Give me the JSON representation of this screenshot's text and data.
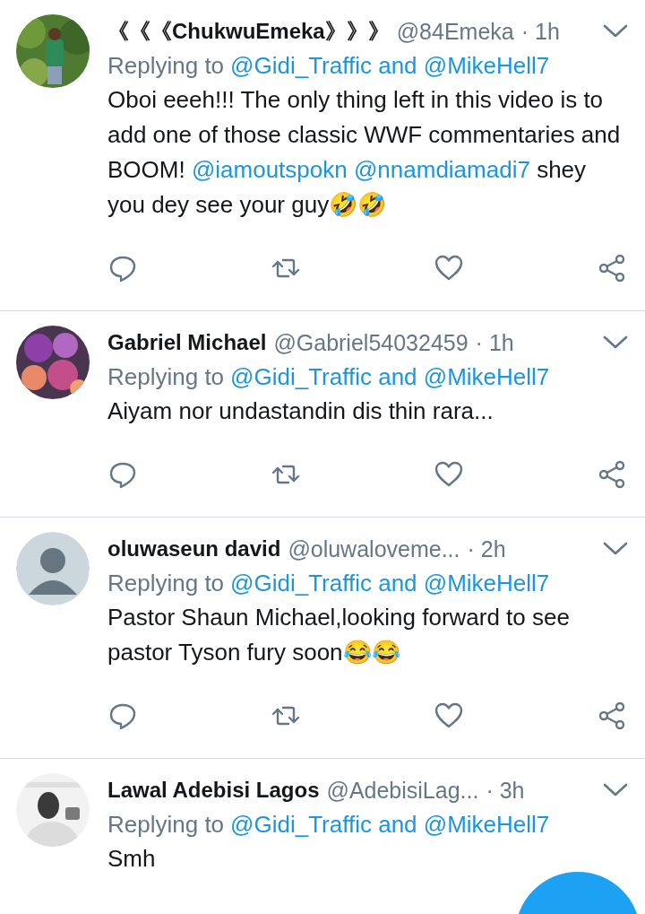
{
  "tweets": [
    {
      "name": "《《《ChukwuEmeka》》》",
      "handle": "@84Emeka",
      "time": "· 1h",
      "replying_prefix": "Replying to",
      "replying_to": "@Gidi_Traffic and @MikeHell7",
      "body": [
        {
          "kind": "text",
          "text": "Oboi eeeh!!! The only thing left in this video is to add one of those classic WWF commentaries and BOOM! "
        },
        {
          "kind": "mention",
          "text": "@iamoutspokn"
        },
        {
          "kind": "mention",
          "text": "@nnamdiamadi7"
        },
        {
          "kind": "text",
          "text": " shey you dey see your guy🤣🤣"
        }
      ],
      "actions": [
        {
          "kind": "reply"
        },
        {
          "kind": "retweet"
        },
        {
          "kind": "like"
        },
        {
          "kind": "share"
        }
      ]
    },
    {
      "name": "Gabriel Michael",
      "handle": "@Gabriel54032459",
      "time": "· 1h",
      "replying_prefix": "Replying to",
      "replying_to": "@Gidi_Traffic and @MikeHell7",
      "body": [
        {
          "kind": "text",
          "text": "Aiyam nor undastandin dis thin rara..."
        }
      ],
      "actions": [
        {
          "kind": "reply"
        },
        {
          "kind": "retweet"
        },
        {
          "kind": "like"
        },
        {
          "kind": "share"
        }
      ]
    },
    {
      "avatar": {
        "kind": "default"
      },
      "name": "oluwaseun david",
      "handle": "@oluwaloveme...",
      "time": "· 2h",
      "replying_prefix": "Replying to",
      "replying_to": "@Gidi_Traffic and @MikeHell7",
      "body": [
        {
          "kind": "text",
          "text": "Pastor Shaun Michael,looking forward to see pastor Tyson fury soon😂😂"
        }
      ],
      "actions": [
        {
          "kind": "reply"
        },
        {
          "kind": "retweet"
        },
        {
          "kind": "like"
        },
        {
          "kind": "share"
        }
      ]
    },
    {
      "name": "Lawal Adebisi Lagos",
      "handle": "@AdebisiLag...",
      "time": "· 3h",
      "replying_prefix": "Replying to",
      "replying_to": "@Gidi_Traffic and @MikeHell7",
      "body": [
        {
          "kind": "text",
          "text": "Smh"
        }
      ]
    }
  ]
}
